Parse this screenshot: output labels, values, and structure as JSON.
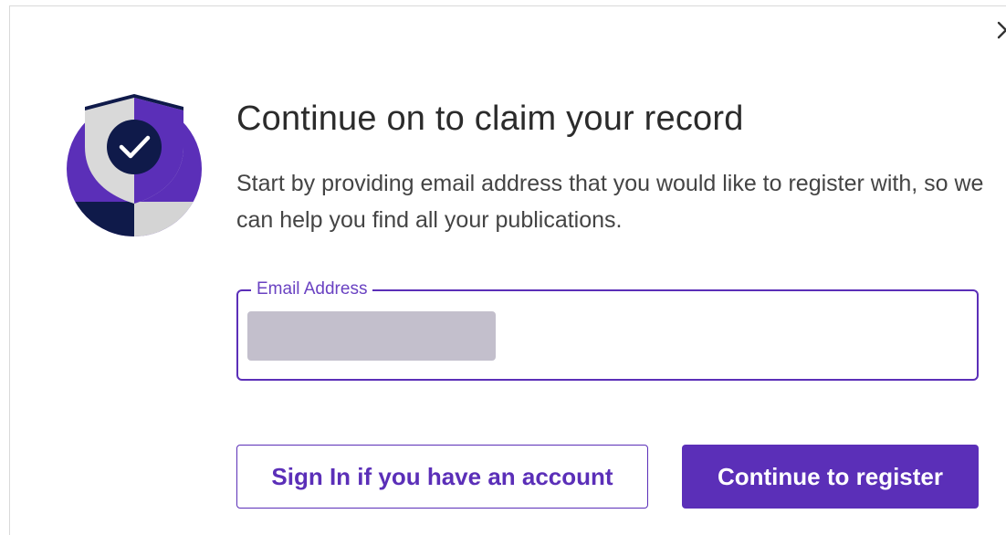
{
  "dialog": {
    "title": "Continue on to claim your record",
    "description": "Start by providing email address that you would like to register with, so we can help you find all your publications.",
    "close_icon": "close-icon",
    "illustration_icon": "shield-check-icon"
  },
  "email": {
    "label": "Email Address",
    "value": "",
    "value_redacted": true
  },
  "actions": {
    "sign_in_label": "Sign In if you have an account",
    "register_label": "Continue to register"
  },
  "colors": {
    "accent": "#5b2fb8",
    "accent_light": "#6a42c2",
    "navy": "#0f1a4a",
    "shield_grey": "#d4d4d4",
    "redaction": "#c3bfcc"
  }
}
